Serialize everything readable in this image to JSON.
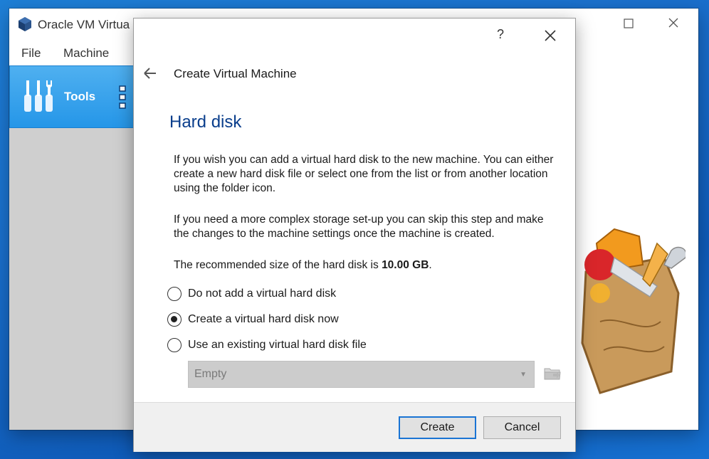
{
  "main_window": {
    "title": "Oracle VM Virtua",
    "controls": {
      "minimize": "—",
      "maximize": "☐",
      "close": "✕"
    },
    "menu": [
      "File",
      "Machine"
    ],
    "tools_label": "Tools"
  },
  "dialog": {
    "help": "?",
    "heading": "Create Virtual Machine",
    "section_title": "Hard disk",
    "paragraph1": "If you wish you can add a virtual hard disk to the new machine. You can either create a new hard disk file or select one from the list or from another location using the folder icon.",
    "paragraph2": "If you need a more complex storage set-up you can skip this step and make the changes to the machine settings once the machine is created.",
    "recommended_prefix": "The recommended size of the hard disk is ",
    "recommended_size": "10.00 GB",
    "recommended_suffix": ".",
    "options": [
      {
        "label": "Do not add a virtual hard disk",
        "checked": false
      },
      {
        "label": "Create a virtual hard disk now",
        "checked": true
      },
      {
        "label": "Use an existing virtual hard disk file",
        "checked": false
      }
    ],
    "disk_combo": {
      "value": "Empty",
      "enabled": false
    },
    "buttons": {
      "create": "Create",
      "cancel": "Cancel"
    }
  },
  "colors": {
    "accent": "#1a74d4",
    "section_title": "#0a3e8c",
    "tools_bg": "#2596e8"
  }
}
